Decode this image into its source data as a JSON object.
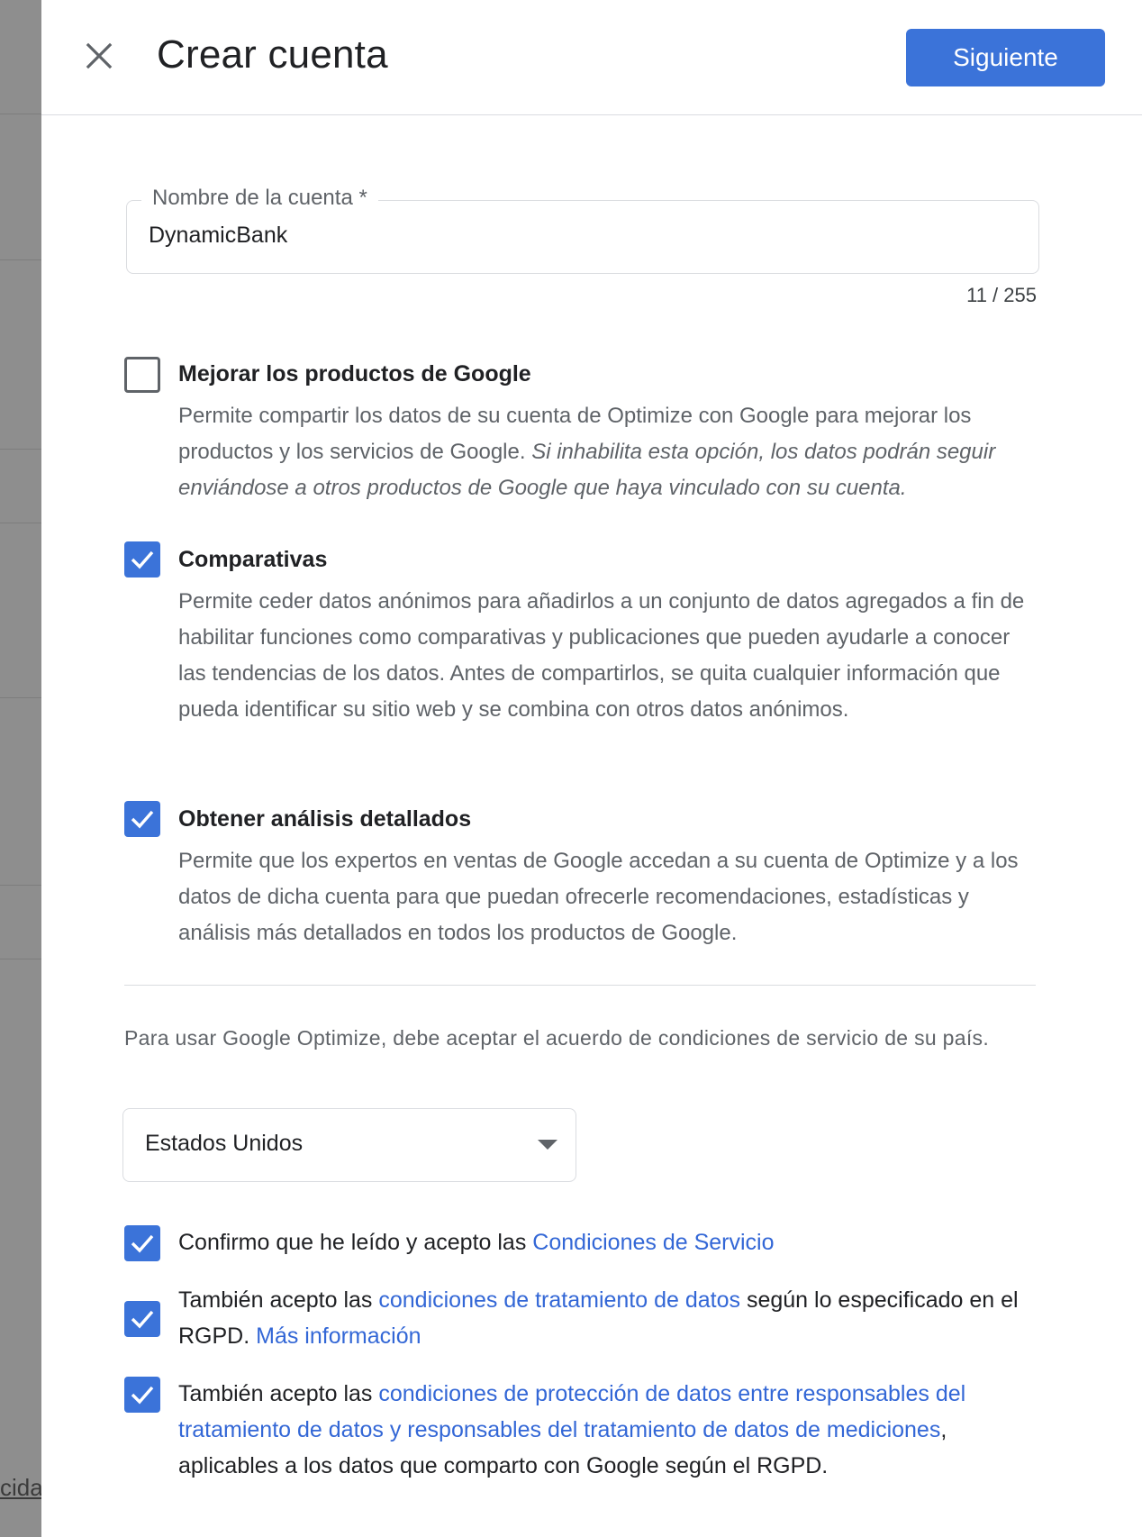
{
  "backdrop": {
    "partial_text": "cida"
  },
  "header": {
    "title": "Crear cuenta",
    "next_label": "Siguiente",
    "close_icon": "close-icon"
  },
  "account_name": {
    "label": "Nombre de la cuenta *",
    "value": "DynamicBank",
    "counter": "11 / 255"
  },
  "options": [
    {
      "title": "Mejorar los productos de Google",
      "checked": false,
      "desc": "Permite compartir los datos de su cuenta de Optimize con Google para mejorar los productos y los servicios de Google.",
      "desc_italic": "Si inhabilita esta opción, los datos podrán seguir enviándose a otros productos de Google que haya vinculado con su cuenta."
    },
    {
      "title": "Comparativas",
      "checked": true,
      "desc": "Permite ceder datos anónimos para añadirlos a un conjunto de datos agregados a fin de habilitar funciones como comparativas y publicaciones que pueden ayudarle a conocer las tendencias de los datos. Antes de compartirlos, se quita cualquier información que pueda identificar su sitio web y se combina con otros datos anónimos."
    },
    {
      "title": "Obtener análisis detallados",
      "checked": true,
      "desc": "Permite que los expertos en ventas de Google accedan a su cuenta de Optimize y a los datos de dicha cuenta para que puedan ofrecerle recomendaciones, estadísticas y análisis más detallados en todos los productos de Google."
    }
  ],
  "terms": {
    "intro": "Para usar Google Optimize, debe aceptar el acuerdo de condiciones de servicio de su país.",
    "country": "Estados Unidos"
  },
  "consents": [
    {
      "checked": true,
      "pre": "Confirmo que he leído y acepto las ",
      "link": "Condiciones de Servicio"
    },
    {
      "checked": true,
      "pre": "También acepto las ",
      "link": "condiciones de tratamiento de datos",
      "mid": " según lo especificado en el RGPD. ",
      "link2": "Más información"
    },
    {
      "checked": true,
      "pre": "También acepto las ",
      "link": "condiciones de protección de datos entre responsables del tratamiento de datos y responsables del tratamiento de datos de mediciones",
      "post": ", aplicables a los datos que comparto con Google según el RGPD."
    }
  ],
  "colors": {
    "accent": "#3b73d9",
    "link": "#3367d6",
    "text": "#202124",
    "muted": "#5f6368",
    "border": "#dadce0"
  }
}
